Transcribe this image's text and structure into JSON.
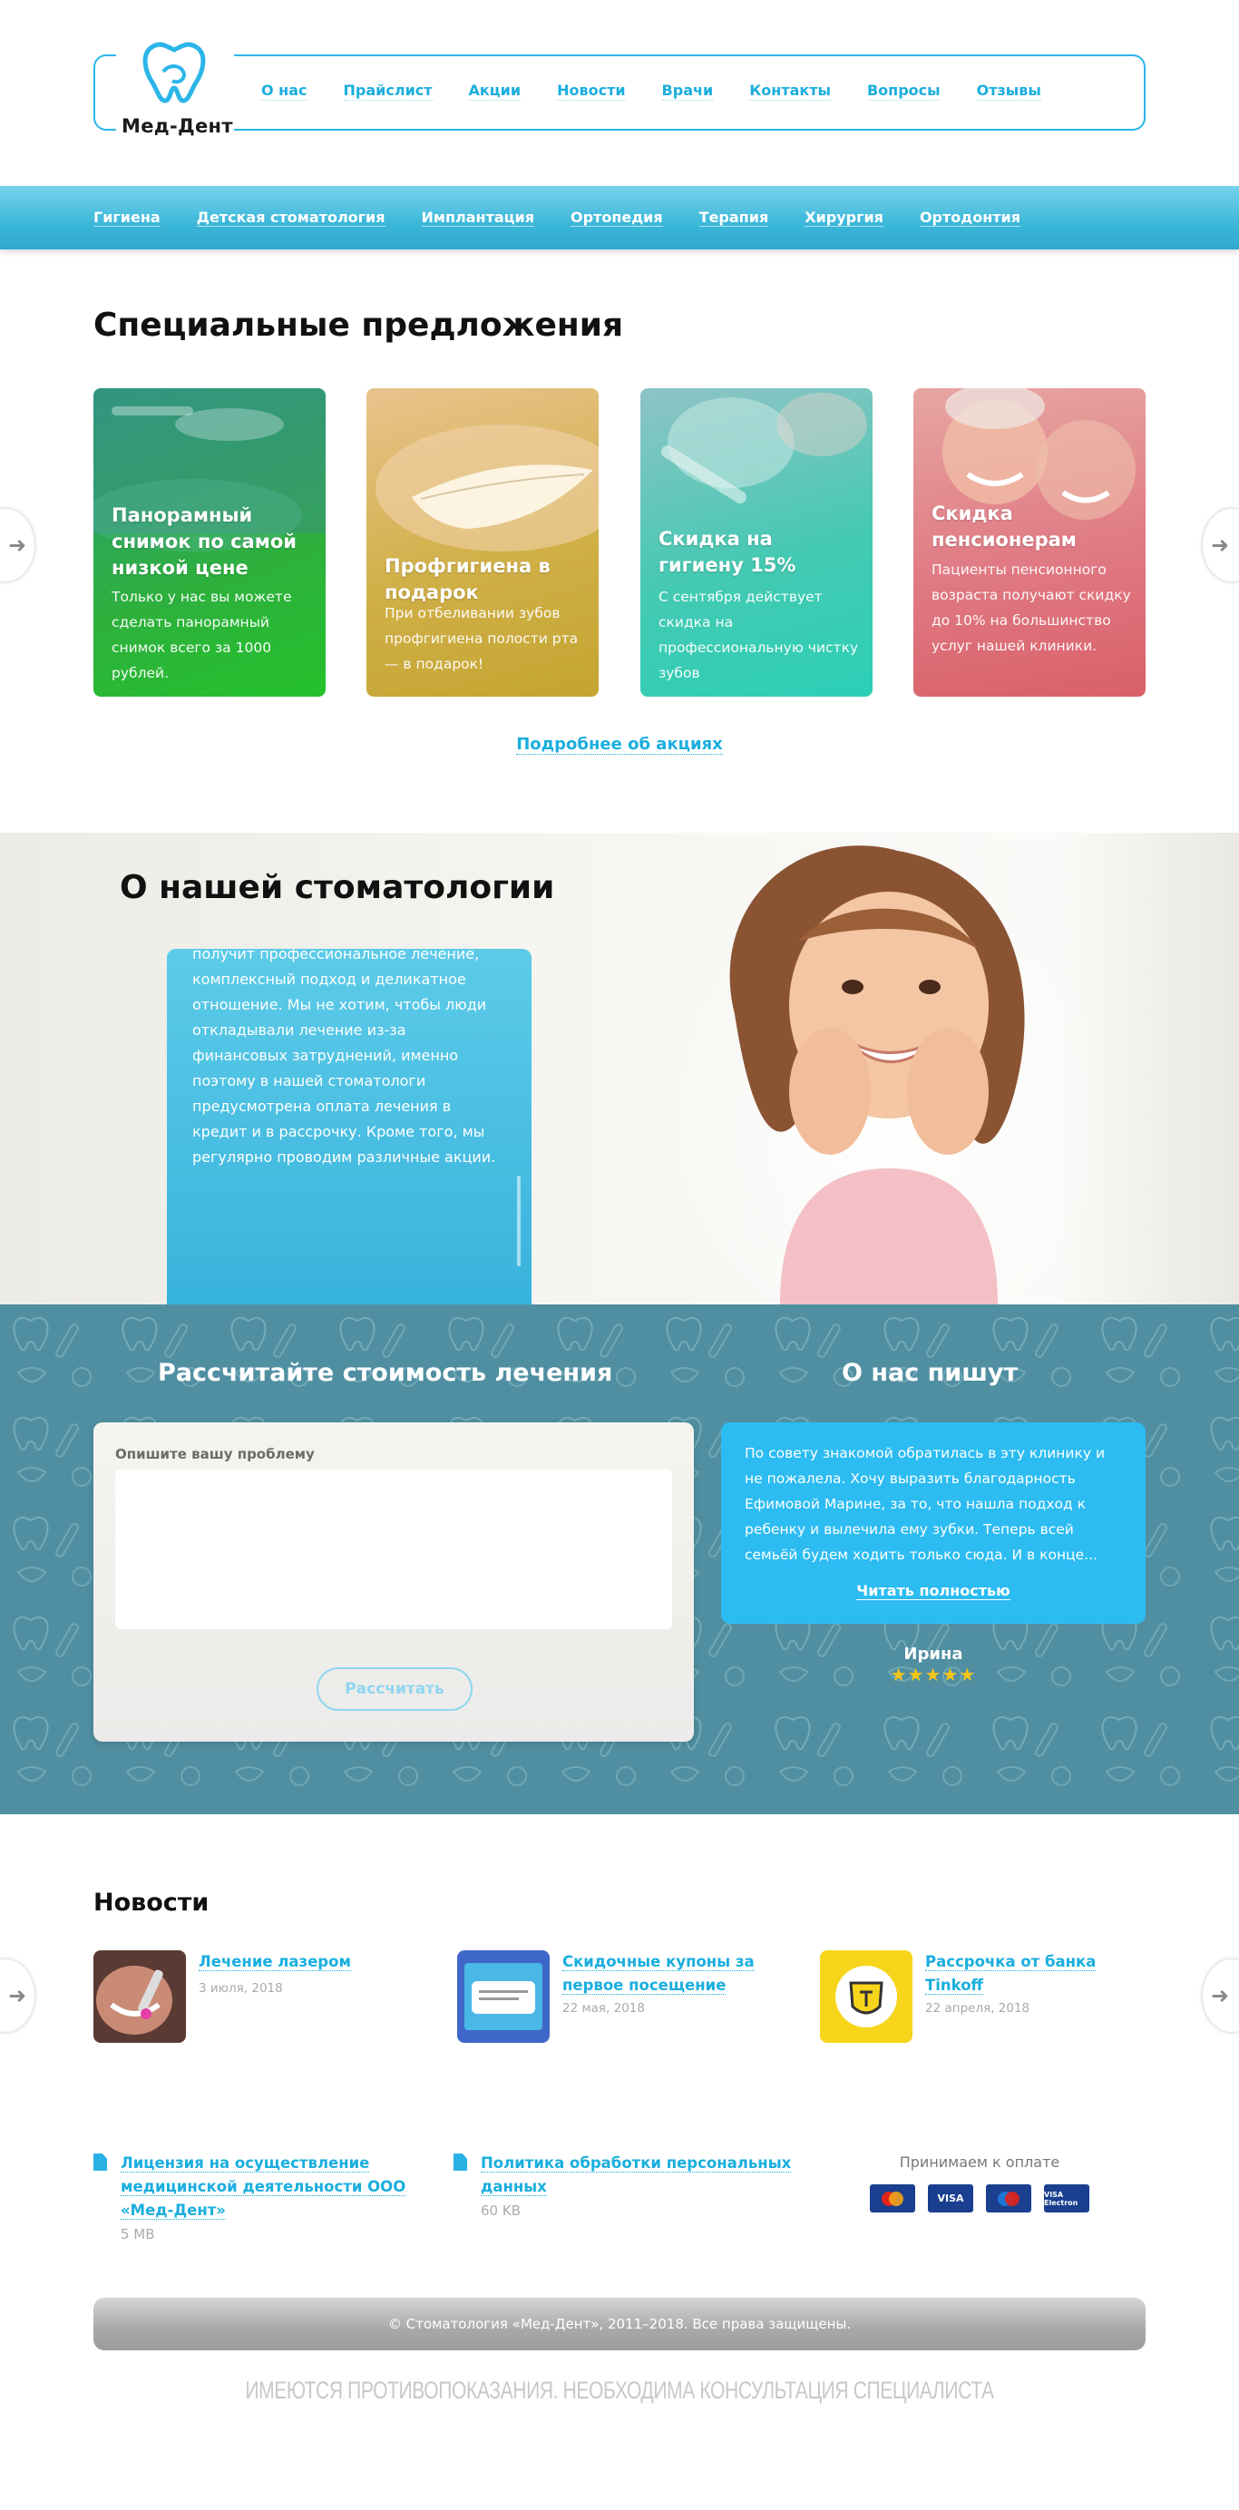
{
  "header": {
    "logo_text": "Мед-Дент",
    "nav": [
      "О нас",
      "Прайслист",
      "Акции",
      "Новости",
      "Врачи",
      "Контакты",
      "Вопросы",
      "Отзывы"
    ]
  },
  "services": [
    "Гигиена",
    "Детская стоматология",
    "Имплантация",
    "Ортопедия",
    "Терапия",
    "Хирургия",
    "Ортодонтия"
  ],
  "offers": {
    "title": "Специальные предложения",
    "items": [
      {
        "title": "Панорамный снимок по самой низкой цене",
        "text": "Только у нас вы можете сделать панорамный снимок всего за 1000 рублей."
      },
      {
        "title": "Профгигиена в подарок",
        "text": "При отбеливании зубов профгигиена полости рта — в подарок!"
      },
      {
        "title": "Скидка на гигиену 15%",
        "text": "С сентября действует скидка на профессиональную чистку зубов"
      },
      {
        "title": "Скидка пенсионерам",
        "text": "Пациенты пенсионного возраста получают скидку до 10% на большинство услуг нашей клиники."
      }
    ],
    "more": "Подробнее об акциях",
    "prev_icon": "arrow-left-icon",
    "next_icon": "arrow-right-icon"
  },
  "about": {
    "title": "О нашей стоматологии",
    "text": "получит профессиональное лечение, комплексный подход и деликатное отношение. Мы не хотим, чтобы люди откладывали лечение из-за финансовых затруднений, именно поэтому в нашей стоматологи предусмотрена оплата лечения в кредит и в рассрочку. Кроме того, мы регулярно проводим различные акции."
  },
  "calc": {
    "title": "Рассчитайте стоимость лечения",
    "label": "Опишите вашу проблему",
    "button": "Рассчитать"
  },
  "press": {
    "title": "О нас пишут",
    "review": "По совету знакомой обратилась в эту клинику и не пожалела. Хочу выразить благодарность Ефимовой Марине, за то, что нашла подход к ребенку и вылечила ему зубки. Теперь всей семьёй будем ходить только сюда. И в конце...",
    "read_more": "Читать полностью",
    "author": "Ирина",
    "stars": "★★★★★",
    "rating": 5
  },
  "news": {
    "title": "Новости",
    "items": [
      {
        "title": "Лечение лазером",
        "date": "3 июля, 2018"
      },
      {
        "title": "Скидочные купоны за первое посещение",
        "date": "22 мая, 2018"
      },
      {
        "title": "Рассрочка от банка Tinkoff",
        "date": "22 апреля, 2018"
      }
    ]
  },
  "footer": {
    "docs": [
      {
        "title": "Лицензия на осуществление медицинской деятельности ООО «Мед-Дент»",
        "size": "5 MB"
      },
      {
        "title": "Политика обработки персональных данных",
        "size": "60 KB"
      }
    ],
    "payment_label": "Принимаем к оплате",
    "payment_cards": [
      "MasterCard",
      "VISA",
      "Maestro",
      "VISA Electron"
    ],
    "copyright": "© Стоматология «Мед-Дент», 2011–2018. Все права защищены.",
    "disclaimer": "ИМЕЮТСЯ ПРОТИВОПОКАЗАНИЯ. НЕОБХОДИМА КОНСУЛЬТАЦИЯ СПЕЦИАЛИСТА"
  },
  "colors": {
    "accent": "#1aaede",
    "band": "#3bb7d9",
    "review": "#2cbcf2",
    "pattern": "#4f8fa1"
  }
}
